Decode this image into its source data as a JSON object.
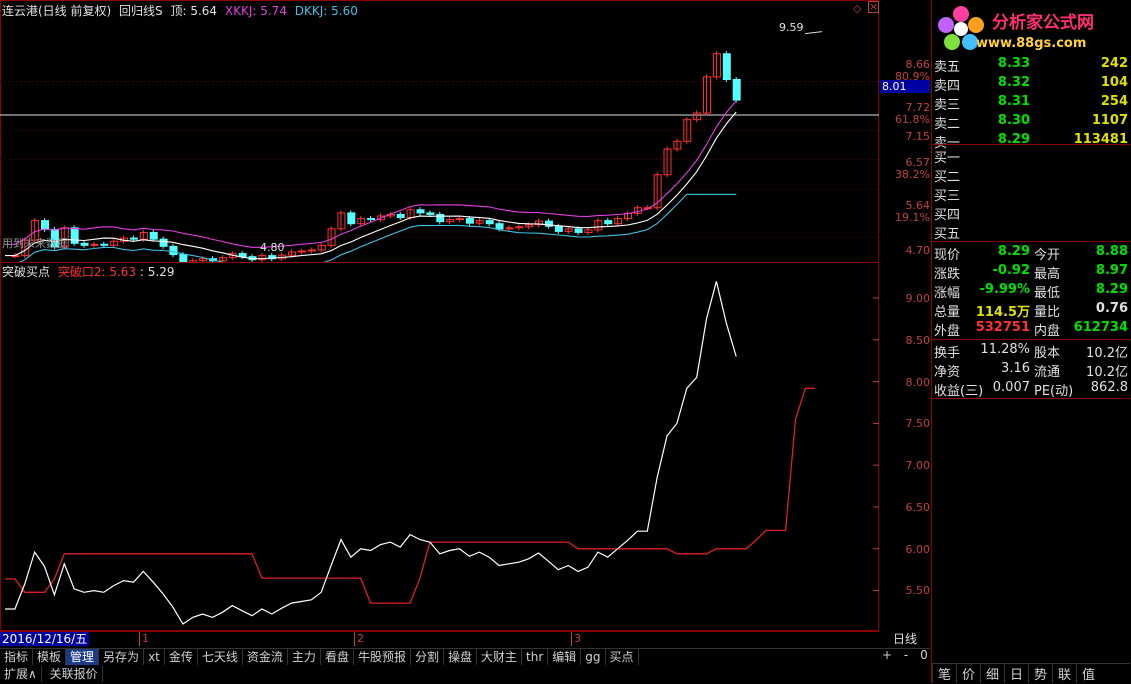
{
  "kline": {
    "title": "连云港(日线 前复权)",
    "indicator": "回归线S",
    "top_label": "顶: 5.64",
    "xkkj_label": "XKKJ: 5.74",
    "dkkj_label": "DKKJ: 5.60",
    "high_annotation": "9.59",
    "low_annotation": "4.80",
    "future_note": "用到未来数据",
    "axis": [
      "8.66",
      "80.9%",
      "7.72",
      "61.8%",
      "7.15",
      "6.57",
      "38.2%",
      "5.64",
      "19.1%",
      "4.70"
    ],
    "price_marker": "8.01"
  },
  "sub": {
    "title": "突破买点",
    "line1_label": "突破口2: 5.63",
    "line2_label": ": 5.29",
    "axis": [
      "9.00",
      "8.50",
      "8.00",
      "7.50",
      "7.00",
      "6.50",
      "6.00",
      "5.50"
    ]
  },
  "timebar": {
    "date": "2016/12/16/五",
    "months": [
      "1",
      "2",
      "3"
    ],
    "period": "日线",
    "controls": [
      "+",
      "-",
      "0"
    ]
  },
  "toolbar": [
    "指标",
    "模板",
    "管理",
    "另存为",
    "xt",
    "金传",
    "七天线",
    "资金流",
    "主力",
    "看盘",
    "牛股预报",
    "分割",
    "操盘",
    "大财主",
    "thr",
    "编辑",
    "gg",
    "买点"
  ],
  "toolbar_selected": "管理",
  "bottom_tabs": [
    "扩展∧",
    "关联报价"
  ],
  "logo": {
    "name": "分析家公式网",
    "url": "www.88gs.com"
  },
  "orderbook": {
    "sells": [
      {
        "label": "卖五",
        "price": "8.33",
        "vol": "242"
      },
      {
        "label": "卖四",
        "price": "8.32",
        "vol": "104"
      },
      {
        "label": "卖三",
        "price": "8.31",
        "vol": "254"
      },
      {
        "label": "卖二",
        "price": "8.30",
        "vol": "1107"
      },
      {
        "label": "卖一",
        "price": "8.29",
        "vol": "113481"
      }
    ],
    "buys": [
      {
        "label": "买一"
      },
      {
        "label": "买二"
      },
      {
        "label": "买三"
      },
      {
        "label": "买四"
      },
      {
        "label": "买五"
      }
    ]
  },
  "stats": [
    {
      "l1": "现价",
      "v1": "8.29",
      "l2": "今开",
      "v2": "8.88"
    },
    {
      "l1": "涨跌",
      "v1": "-0.92",
      "l2": "最高",
      "v2": "8.97"
    },
    {
      "l1": "涨幅",
      "v1": "-9.99%",
      "l2": "最低",
      "v2": "8.29"
    },
    {
      "l1": "总量",
      "v1": "114.5万",
      "l2": "量比",
      "v2": "0.76"
    },
    {
      "l1": "外盘",
      "v1": "532751",
      "l2": "内盘",
      "v2": "612734"
    }
  ],
  "fund": [
    {
      "l1": "换手",
      "v1": "11.28%",
      "l2": "股本",
      "v2": "10.2亿"
    },
    {
      "l1": "净资",
      "v1": "3.16",
      "l2": "流通",
      "v2": "10.2亿"
    },
    {
      "l1": "收益(三)",
      "v1": "0.007",
      "l2": "PE(动)",
      "v2": "862.8"
    }
  ],
  "nav": [
    "笔",
    "价",
    "细",
    "日",
    "势",
    "联",
    "值"
  ],
  "colors": {
    "up": "#ff3030",
    "down": "#54ffff",
    "ma": "#ffffff",
    "upper": "#e040e0",
    "lower": "#40c0e0",
    "green": "#00e000",
    "yellow": "#e0e000"
  },
  "chart_data": [
    {
      "type": "line",
      "name": "突破买点",
      "x": [
        1,
        2,
        3,
        4,
        5,
        6,
        7,
        8,
        9,
        10,
        11,
        12,
        13,
        14,
        15,
        16,
        17,
        18,
        19,
        20,
        21,
        22,
        23,
        24,
        25,
        26,
        27,
        28,
        29,
        30,
        31,
        32,
        33,
        34,
        35,
        36,
        37,
        38,
        39,
        40,
        41,
        42,
        43,
        44,
        45,
        46,
        47,
        48,
        49,
        50,
        51,
        52,
        53,
        54,
        55,
        56,
        57,
        58,
        59,
        60,
        61,
        62,
        63,
        64,
        65,
        66,
        67,
        68,
        69,
        70,
        71,
        72,
        73,
        74,
        75,
        76,
        77,
        78,
        79,
        80,
        81,
        82,
        83,
        84,
        85
      ],
      "series": [
        {
          "name": "突破口2",
          "values": [
            5.64,
            5.64,
            5.48,
            5.48,
            5.48,
            5.64,
            5.94,
            5.94,
            5.94,
            5.94,
            5.94,
            5.94,
            5.94,
            5.94,
            5.94,
            5.94,
            5.94,
            5.94,
            5.94,
            5.94,
            5.94,
            5.94,
            5.94,
            5.94,
            5.94,
            5.94,
            5.65,
            5.65,
            5.65,
            5.65,
            5.65,
            5.65,
            5.65,
            5.65,
            5.65,
            5.65,
            5.65,
            5.35,
            5.35,
            5.35,
            5.35,
            5.35,
            5.65,
            6.08,
            6.08,
            6.08,
            6.08,
            6.08,
            6.08,
            6.08,
            6.08,
            6.08,
            6.08,
            6.08,
            6.08,
            6.08,
            6.08,
            6.08,
            6.0,
            6.0,
            6.0,
            6.0,
            6.0,
            6.0,
            6.0,
            6.0,
            6.0,
            6.0,
            5.94,
            5.94,
            5.94,
            5.94,
            6.0,
            6.0,
            6.0,
            6.0,
            6.1,
            6.22,
            6.22,
            6.22,
            7.55,
            7.92,
            7.92
          ]
        },
        {
          "name": "5.29",
          "values": [
            5.28,
            5.28,
            5.58,
            5.96,
            5.79,
            5.45,
            5.82,
            5.52,
            5.48,
            5.5,
            5.48,
            5.56,
            5.62,
            5.6,
            5.73,
            5.6,
            5.46,
            5.3,
            5.1,
            5.18,
            5.22,
            5.18,
            5.24,
            5.32,
            5.26,
            5.2,
            5.28,
            5.22,
            5.29,
            5.35,
            5.37,
            5.39,
            5.48,
            5.8,
            6.11,
            5.9,
            6.0,
            5.98,
            6.05,
            6.08,
            6.02,
            6.17,
            6.11,
            6.08,
            5.94,
            5.98,
            6.0,
            5.91,
            5.96,
            5.9,
            5.8,
            5.82,
            5.84,
            5.88,
            5.95,
            5.85,
            5.75,
            5.8,
            5.73,
            5.78,
            5.96,
            5.9,
            6.0,
            6.1,
            6.21,
            6.21,
            6.85,
            7.35,
            7.5,
            7.92,
            8.05,
            8.75,
            9.2,
            8.7,
            8.3
          ]
        }
      ]
    }
  ]
}
